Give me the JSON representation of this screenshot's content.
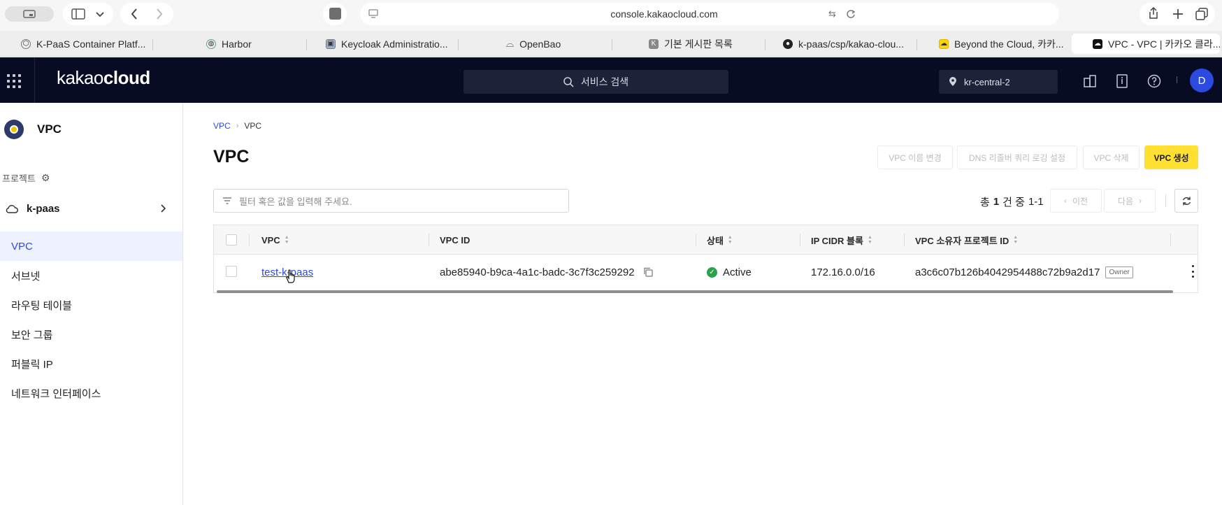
{
  "browser": {
    "url": "console.kakaocloud.com",
    "tabs": [
      {
        "label": "K-PaaS Container Platf...",
        "icon": "kpaas-icon"
      },
      {
        "label": "Harbor",
        "icon": "harbor-icon"
      },
      {
        "label": "Keycloak Administratio...",
        "icon": "keycloak-icon"
      },
      {
        "label": "OpenBao",
        "icon": "openbao-icon"
      },
      {
        "label": "기본 게시판 목록",
        "icon": "k-board-icon"
      },
      {
        "label": "k-paas/csp/kakao-clou...",
        "icon": "github-icon"
      },
      {
        "label": "Beyond the Cloud, 카카...",
        "icon": "kakaocloud-icon"
      },
      {
        "label": "VPC - VPC | 카카오 클라...",
        "icon": "kakaocloud-dark-icon"
      }
    ]
  },
  "header": {
    "logo_light": "kakao",
    "logo_bold": "cloud",
    "search_placeholder": "서비스 검색",
    "region": "kr-central-2",
    "avatar": "D"
  },
  "sidebar": {
    "service_title": "VPC",
    "project_label": "프로젝트",
    "project_name": "k-paas",
    "items": [
      {
        "label": "VPC",
        "active": true
      },
      {
        "label": "서브넷"
      },
      {
        "label": "라우팅 테이블"
      },
      {
        "label": "보안 그룹"
      },
      {
        "label": "퍼블릭 IP"
      },
      {
        "label": "네트워크 인터페이스"
      }
    ]
  },
  "main": {
    "breadcrumb": [
      "VPC",
      "VPC"
    ],
    "title": "VPC",
    "actions": {
      "rename": "VPC 이름 변경",
      "dns_logging": "DNS 리졸버 쿼리 로깅 설정",
      "delete": "VPC 삭제",
      "create": "VPC 생성"
    },
    "filter_placeholder": "필터 혹은 값을 입력해 주세요.",
    "pagination": {
      "total_prefix": "총",
      "total_count": "1",
      "total_unit": "건 중",
      "range": "1-1",
      "prev": "이전",
      "next": "다음"
    },
    "table": {
      "columns": [
        "VPC",
        "VPC ID",
        "상태",
        "IP CIDR 블록",
        "VPC 소유자 프로젝트 ID"
      ],
      "rows": [
        {
          "vpc": "test-k-paas",
          "vpc_id": "abe85940-b9ca-4a1c-badc-3c7f3c259292",
          "status": "Active",
          "cidr": "172.16.0.0/16",
          "owner_project_id": "a3c6c07b126b4042954488c72b9a2d17",
          "owner_badge": "Owner"
        }
      ]
    }
  },
  "colors": {
    "header_bg": "#070b24",
    "accent": "#2b4be0",
    "primary_button": "#ffe033",
    "status_active": "#27a34a"
  }
}
